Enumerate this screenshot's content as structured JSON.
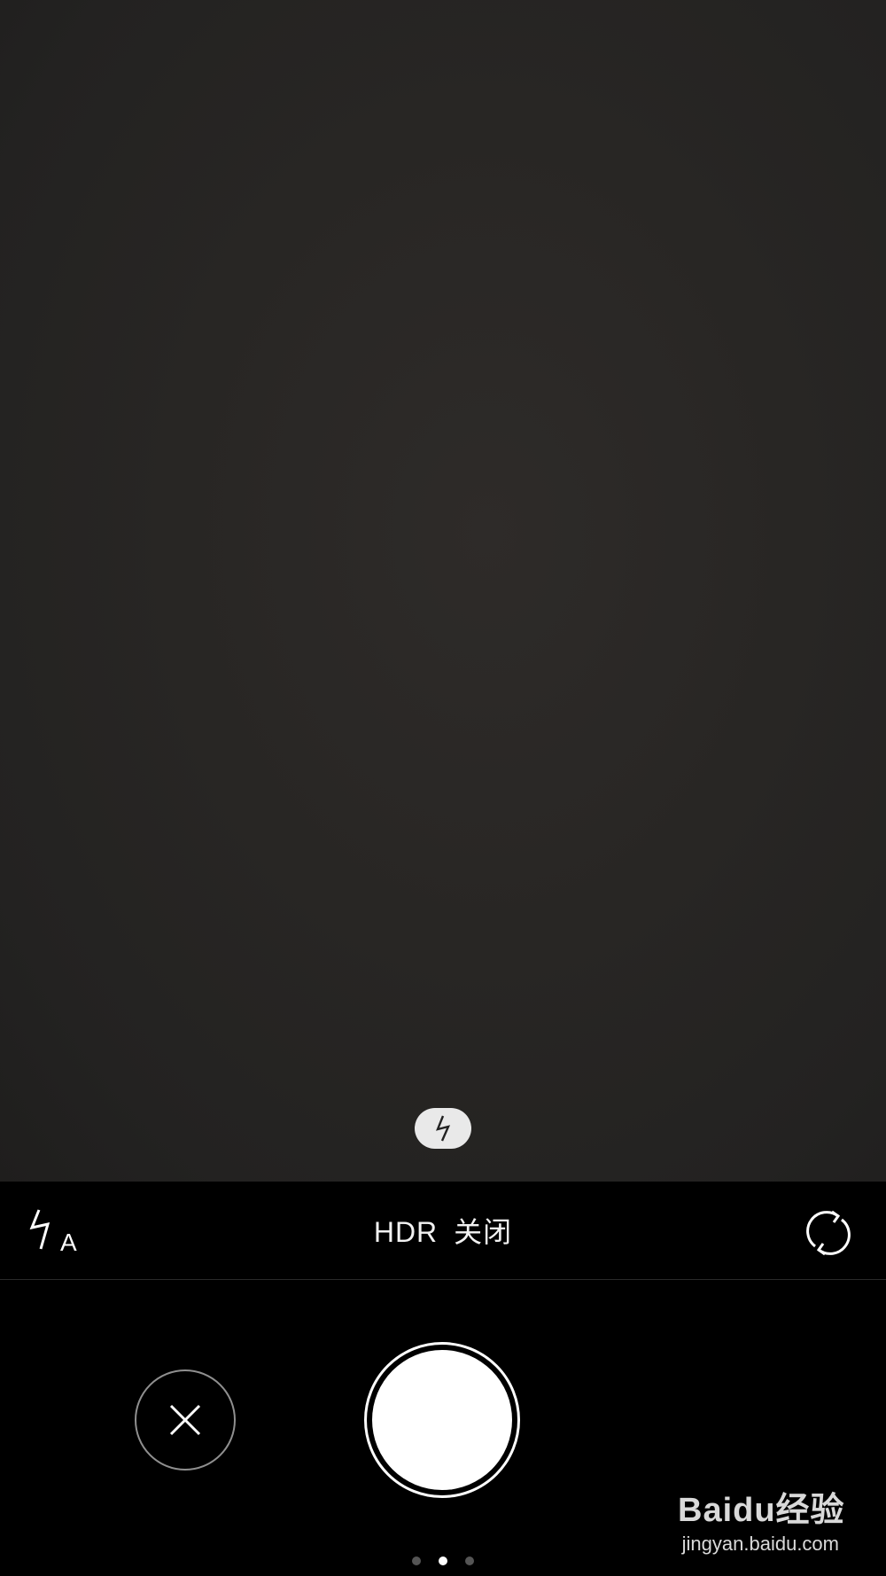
{
  "viewfinder": {
    "flash_indicator": "flash-icon"
  },
  "toolbar": {
    "flash_mode_icon": "flash-auto-icon",
    "flash_mode_letter": "A",
    "hdr_label": "HDR",
    "hdr_state": "关闭",
    "switch_camera_icon": "switch-camera-icon"
  },
  "controls": {
    "cancel_icon": "close-icon",
    "shutter_icon": "shutter-button"
  },
  "pager": {
    "count": 3,
    "active_index": 1
  },
  "watermark": {
    "brand": "Baidu经验",
    "url": "jingyan.baidu.com"
  },
  "colors": {
    "background": "#000000",
    "viewfinder": "#282624",
    "foreground": "#ffffff"
  }
}
